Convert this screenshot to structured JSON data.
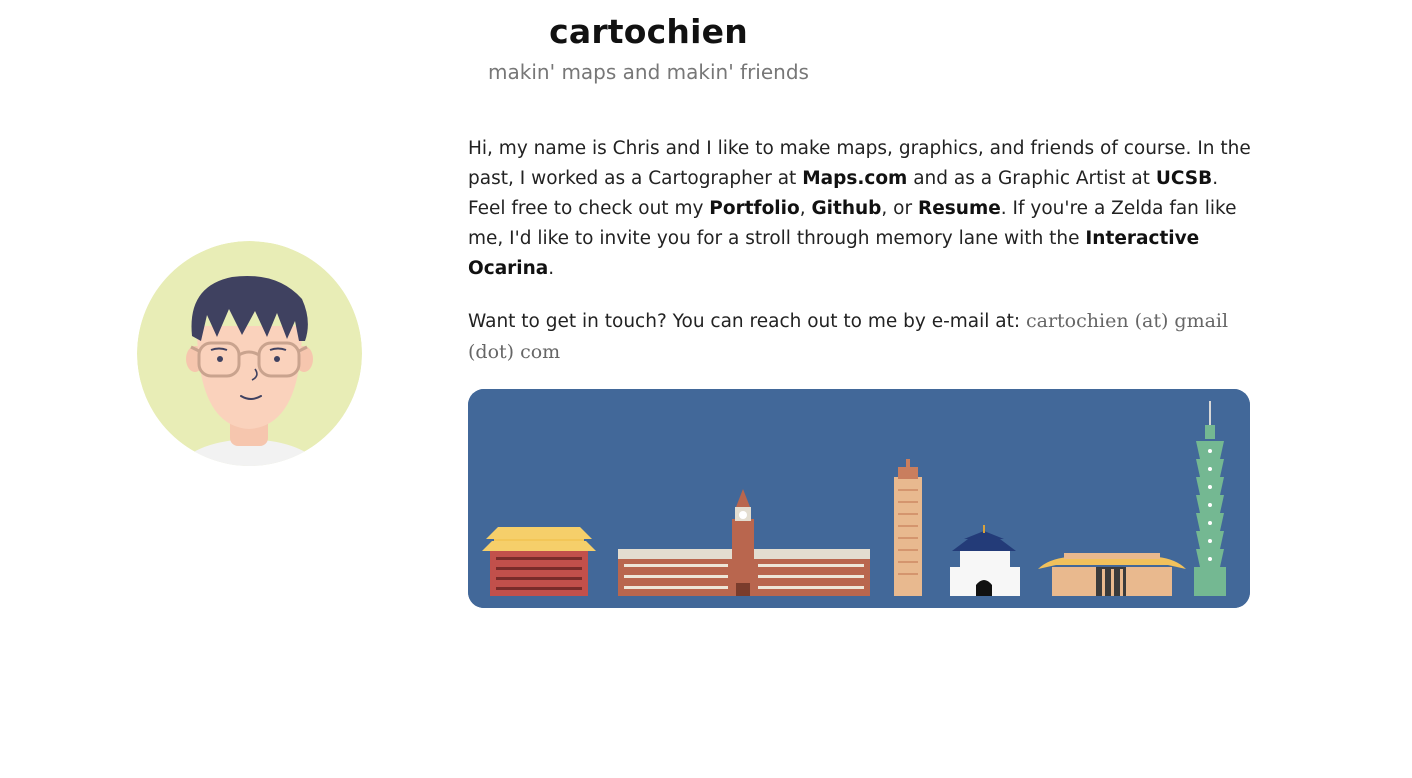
{
  "header": {
    "title": "cartochien",
    "subtitle": "makin' maps and makin' friends"
  },
  "bio": {
    "p1_a": "Hi, my name is Chris and I like to make maps, graphics, and friends of course. In the past, I worked as a Cartographer at ",
    "link_maps": "Maps.com",
    "p1_b": " and as a Graphic Artist at ",
    "link_ucsb": "UCSB",
    "p1_c": ". Feel free to check out my ",
    "link_portfolio": "Portfolio",
    "p1_d": ", ",
    "link_github": "Github",
    "p1_e": ", or ",
    "link_resume": "Resume",
    "p1_f": ". If you're a Zelda fan like me, I'd like to invite you for a stroll through memory lane with the ",
    "link_ocarina": "Interactive Ocarina",
    "p1_g": "."
  },
  "contact": {
    "lead": "Want to get in touch? You can reach out to me by e-mail at: ",
    "email": "cartochien (at) gmail (dot) com"
  },
  "colors": {
    "avatar_bg": "#E8EDB6",
    "skyline_bg": "#426899",
    "hair": "#3F4160",
    "skin": "#FAD2BC"
  },
  "icons": {
    "avatar": "avatar-illustration",
    "skyline": "taipei-skyline-illustration"
  }
}
